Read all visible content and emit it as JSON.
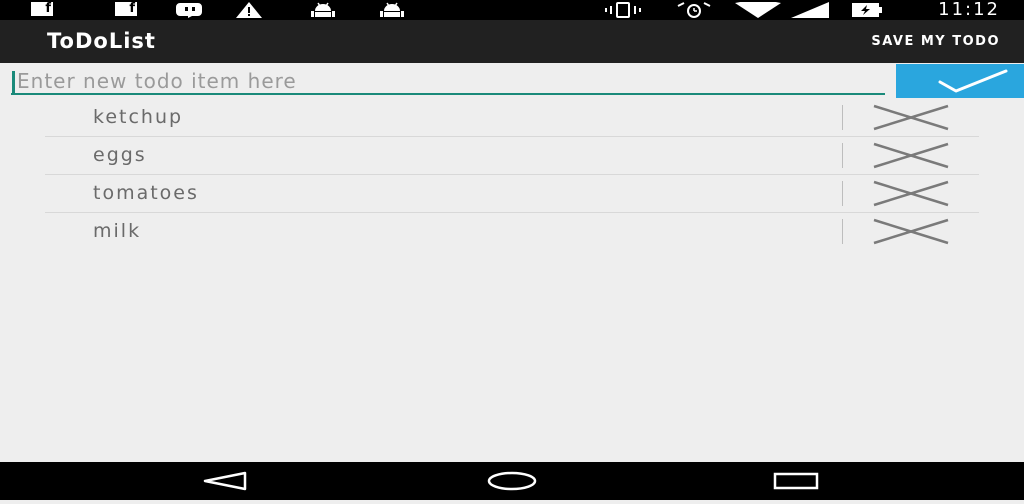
{
  "status_bar": {
    "notification_icons": [
      "facebook-icon",
      "facebook-icon",
      "hangouts-icon",
      "warning-icon",
      "android-icon",
      "android-icon"
    ],
    "system_icons": [
      "vibrate-icon",
      "alarm-icon",
      "wifi-icon",
      "signal-icon",
      "battery-charging-icon"
    ],
    "fb_glyph": "f",
    "time": "11:12"
  },
  "action_bar": {
    "title": "ToDoList",
    "save_label": "SAVE MY TODO"
  },
  "new_item": {
    "placeholder": "Enter new todo item here",
    "value": "",
    "add_icon": "checkmark-icon"
  },
  "todo_items": [
    {
      "label": "ketchup"
    },
    {
      "label": "eggs"
    },
    {
      "label": "tomatoes"
    },
    {
      "label": "milk"
    }
  ],
  "colors": {
    "action_bar_bg": "#212121",
    "accent_teal": "#1a8a7a",
    "add_button_bg": "#2aa6de",
    "background": "#eeeeee"
  },
  "nav_bar": {
    "buttons": [
      "back-icon",
      "home-icon",
      "recents-icon"
    ]
  }
}
